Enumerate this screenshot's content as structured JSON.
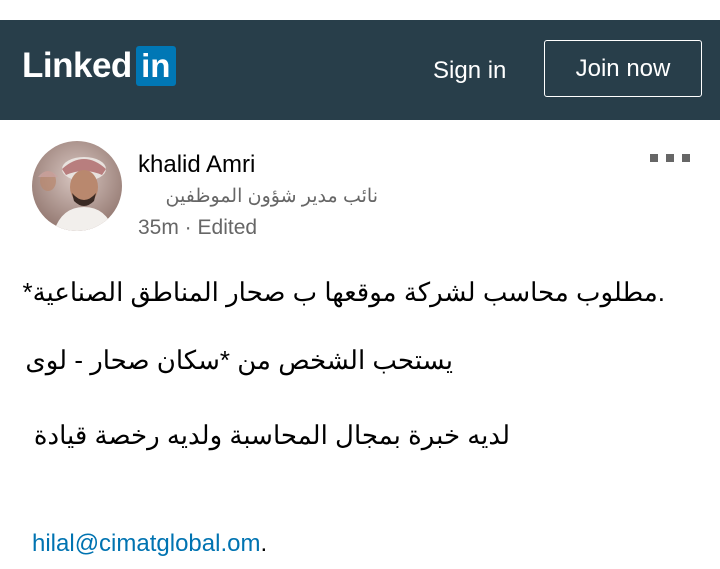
{
  "header": {
    "logo_word": "Linked",
    "logo_box": "in",
    "sign_in": "Sign in",
    "join_now": "Join now",
    "bg_color": "#283e4a",
    "brand_blue": "#0077b5"
  },
  "post": {
    "author": {
      "name": "khalid Amri",
      "headline": "نائب مدير شؤون الموظفين",
      "meta": "35m · Edited"
    },
    "lines": [
      ".مطلوب محاسب لشركة موقعها ب صحار المناطق الصناعية*",
      "يستحب الشخص من *سكان صحار - لوى",
      "لديه خبرة بمجال المحاسبة ولديه رخصة قيادة"
    ],
    "email": "hilal@cimatglobal.om",
    "email_suffix": ".",
    "more_icon": "more-horizontal-icon",
    "link_color": "#0073b1"
  }
}
